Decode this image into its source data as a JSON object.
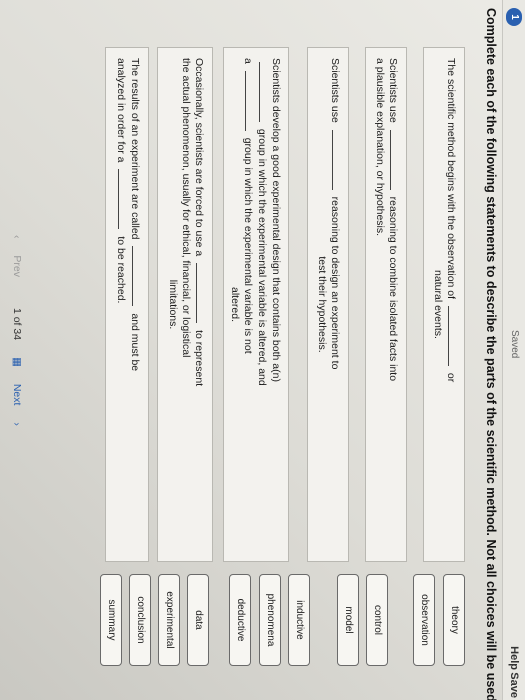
{
  "topbar": {
    "badge": "1",
    "saved_label": "Saved",
    "help_label": "Help",
    "save_label": "Save"
  },
  "instruction": "Complete each of the following statements to describe the parts of the scientific method. Not all choices will be used.",
  "statements": [
    {
      "line1_a": "The scientific method begins with the observation of",
      "line1_b": "or",
      "line2": "natural events."
    },
    {
      "line1_a": "Scientists use",
      "line1_b": "reasoning to combine isolated facts into",
      "line2": "a plausible explanation, or hypothesis."
    },
    {
      "line1_a": "Scientists use",
      "line1_b": "reasoning to design an experiment to",
      "line2": "test their hypothesis."
    },
    {
      "line1": "Scientists develop a good experimental design that contains both a(n)",
      "line2": "group in which the experimental variable is altered, and",
      "line3_a": "a",
      "line3_b": "group in which the experimental variable is not",
      "line4": "altered."
    },
    {
      "line1_a": "Occasionally, scientists are forced to use a",
      "line1_b": "to represent",
      "line2": "the actual phenomenon, usually for ethical, financial, or logistical",
      "line3": "limitations."
    },
    {
      "line1_a": "The results of an experiment are called",
      "line1_b": "and must be",
      "line2_a": "analyzed in order for a",
      "line2_b": "to be reached."
    }
  ],
  "choices": [
    "theory",
    "observation",
    "control",
    "model",
    "inductive",
    "phenomena",
    "deductive",
    "data",
    "experimental",
    "conclusion",
    "summary"
  ],
  "pager": {
    "prev_label": "Prev",
    "page_label": "1 of 34",
    "next_label": "Next"
  }
}
